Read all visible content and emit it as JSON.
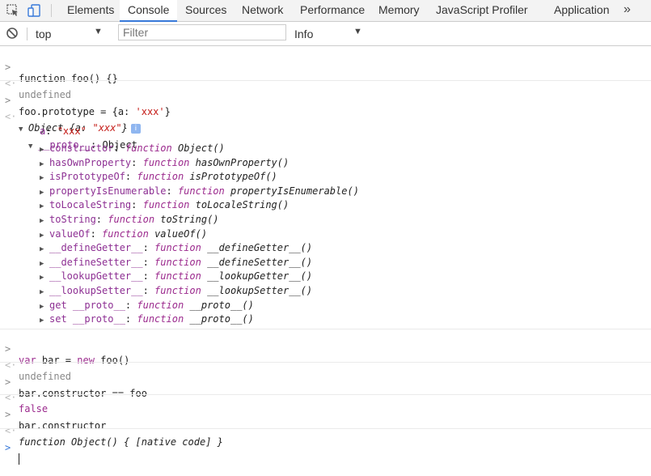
{
  "tabs": [
    "Elements",
    "Console",
    "Sources",
    "Network",
    "Performance",
    "Memory",
    "JavaScript Profiler",
    "Application"
  ],
  "active_tab": "Console",
  "more_label": "»",
  "toolbar": {
    "context_value": "top",
    "filter_placeholder": "Filter",
    "level_value": "Info"
  },
  "console": {
    "cmd1": "function foo() {}",
    "res1": "undefined",
    "cmd2_a": "foo.prototype = {a: ",
    "cmd2_b": "'xxx'",
    "cmd2_c": "}",
    "obj_head_a": "Object {a: ",
    "obj_head_b": "\"xxx\"",
    "obj_head_c": "}",
    "prop_a_key": "a",
    "prop_a_val": "\"xxx\"",
    "proto_key": "__proto__",
    "proto_val": "Object",
    "proto_items": [
      {
        "key": "constructor",
        "sig": "Object()"
      },
      {
        "key": "hasOwnProperty",
        "sig": "hasOwnProperty()"
      },
      {
        "key": "isPrototypeOf",
        "sig": "isPrototypeOf()"
      },
      {
        "key": "propertyIsEnumerable",
        "sig": "propertyIsEnumerable()"
      },
      {
        "key": "toLocaleString",
        "sig": "toLocaleString()"
      },
      {
        "key": "toString",
        "sig": "toString()"
      },
      {
        "key": "valueOf",
        "sig": "valueOf()"
      },
      {
        "key": "__defineGetter__",
        "sig": "__defineGetter__()"
      },
      {
        "key": "__defineSetter__",
        "sig": "__defineSetter__()"
      },
      {
        "key": "__lookupGetter__",
        "sig": "__lookupGetter__()"
      },
      {
        "key": "__lookupSetter__",
        "sig": "__lookupSetter__()"
      },
      {
        "key": "get __proto__",
        "sig": "__proto__()"
      },
      {
        "key": "set __proto__",
        "sig": "__proto__()"
      }
    ],
    "fn_keyword": "function",
    "cmd3_a": "var",
    "cmd3_b": " bar = ",
    "cmd3_c": "new",
    "cmd3_d": " foo()",
    "res3": "undefined",
    "cmd4": "bar.constructor == foo",
    "res4": "false",
    "cmd5": "bar.constructor",
    "res5": "function Object() { [native code] }"
  },
  "icons": {
    "inspect": "inspect-element-icon",
    "device": "device-toolbar-icon",
    "clear": "clear-console-icon",
    "info_badge": "info-badge-icon"
  }
}
